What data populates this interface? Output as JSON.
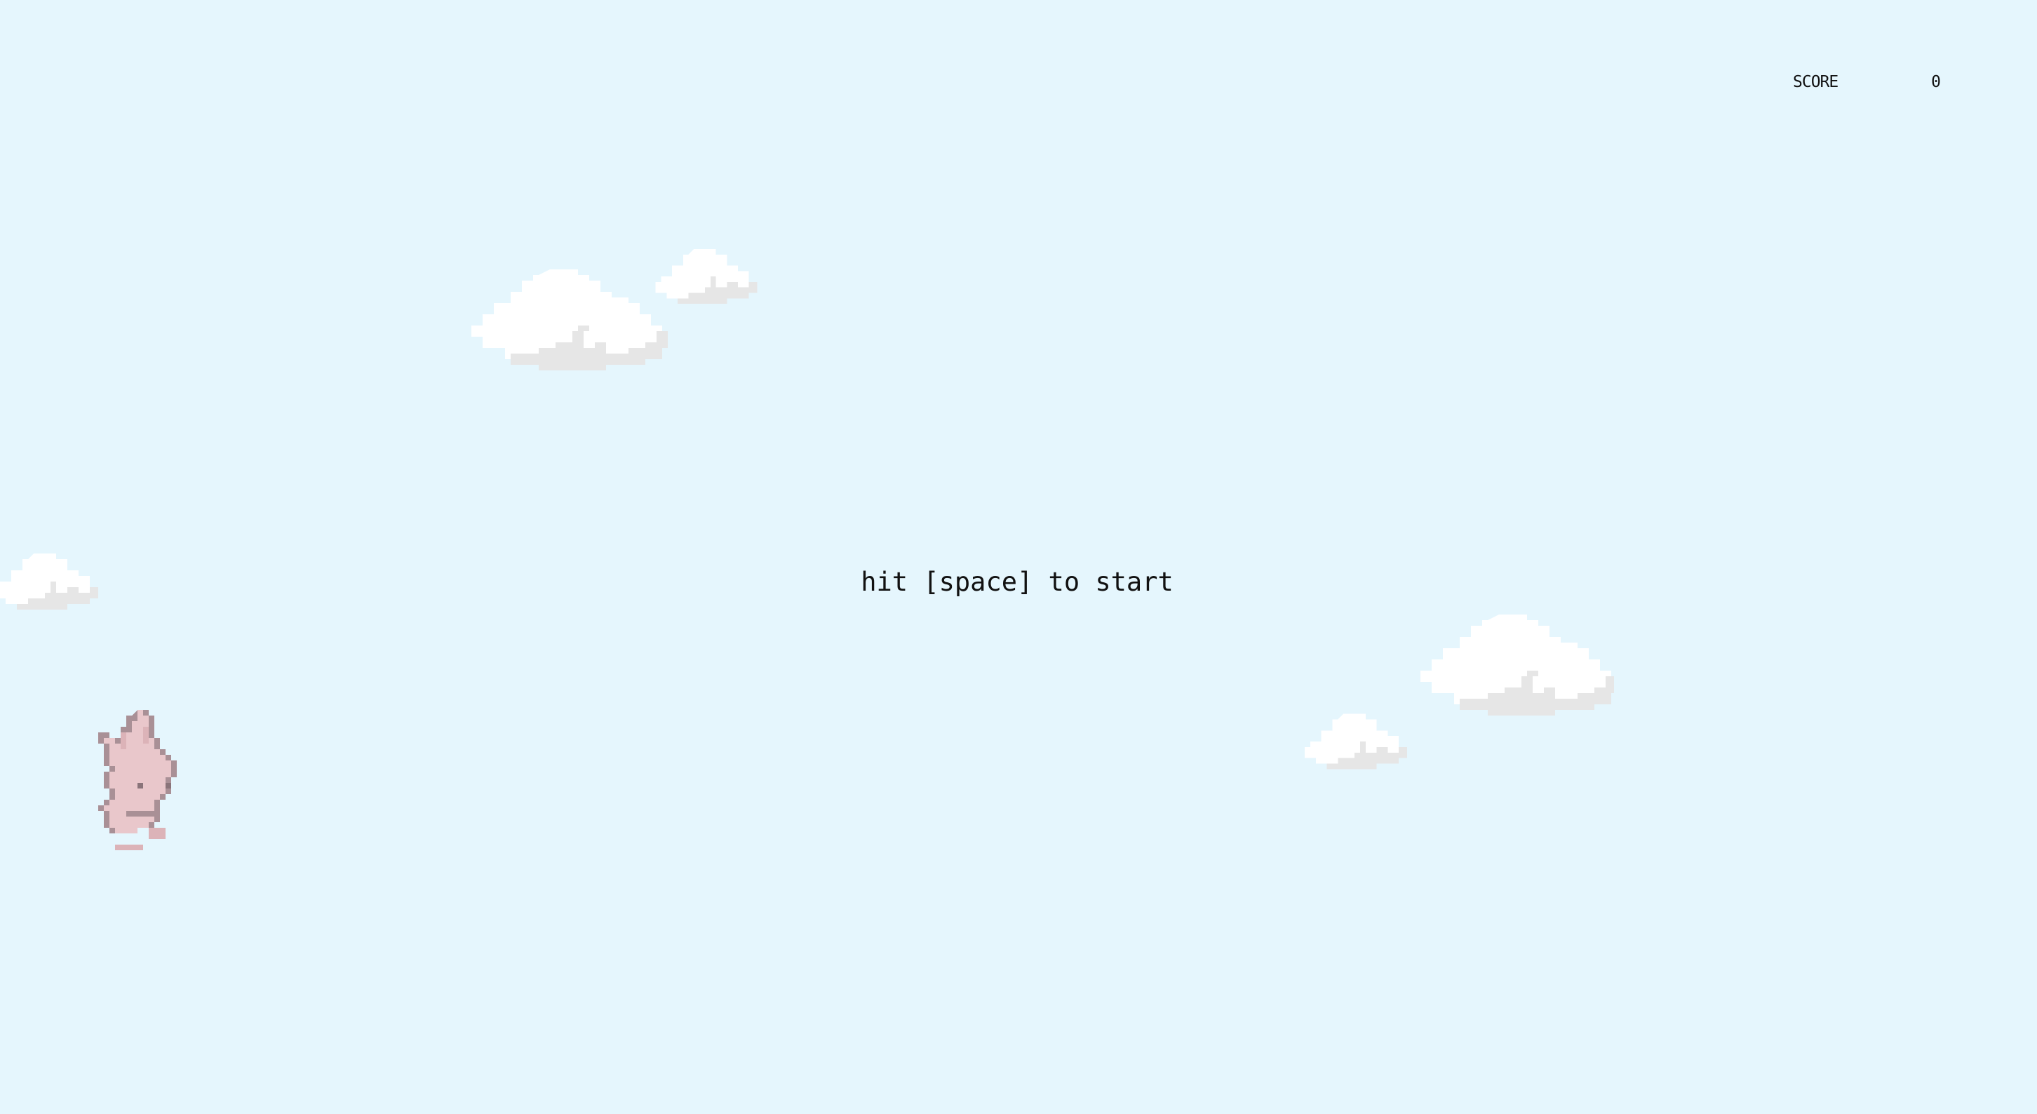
{
  "hud": {
    "score_label": "SCORE",
    "score_value": "0"
  },
  "prompt": {
    "start_text": "hit [space] to start"
  },
  "scene": {
    "sky_color": "#e5f6fd",
    "cloud_color": "#ffffff",
    "cloud_shadow_color": "#e6e6e6",
    "player_sprite": "pink-bunny",
    "bunny_fill": "#e9c7cb",
    "bunny_outline": "#a99096"
  }
}
